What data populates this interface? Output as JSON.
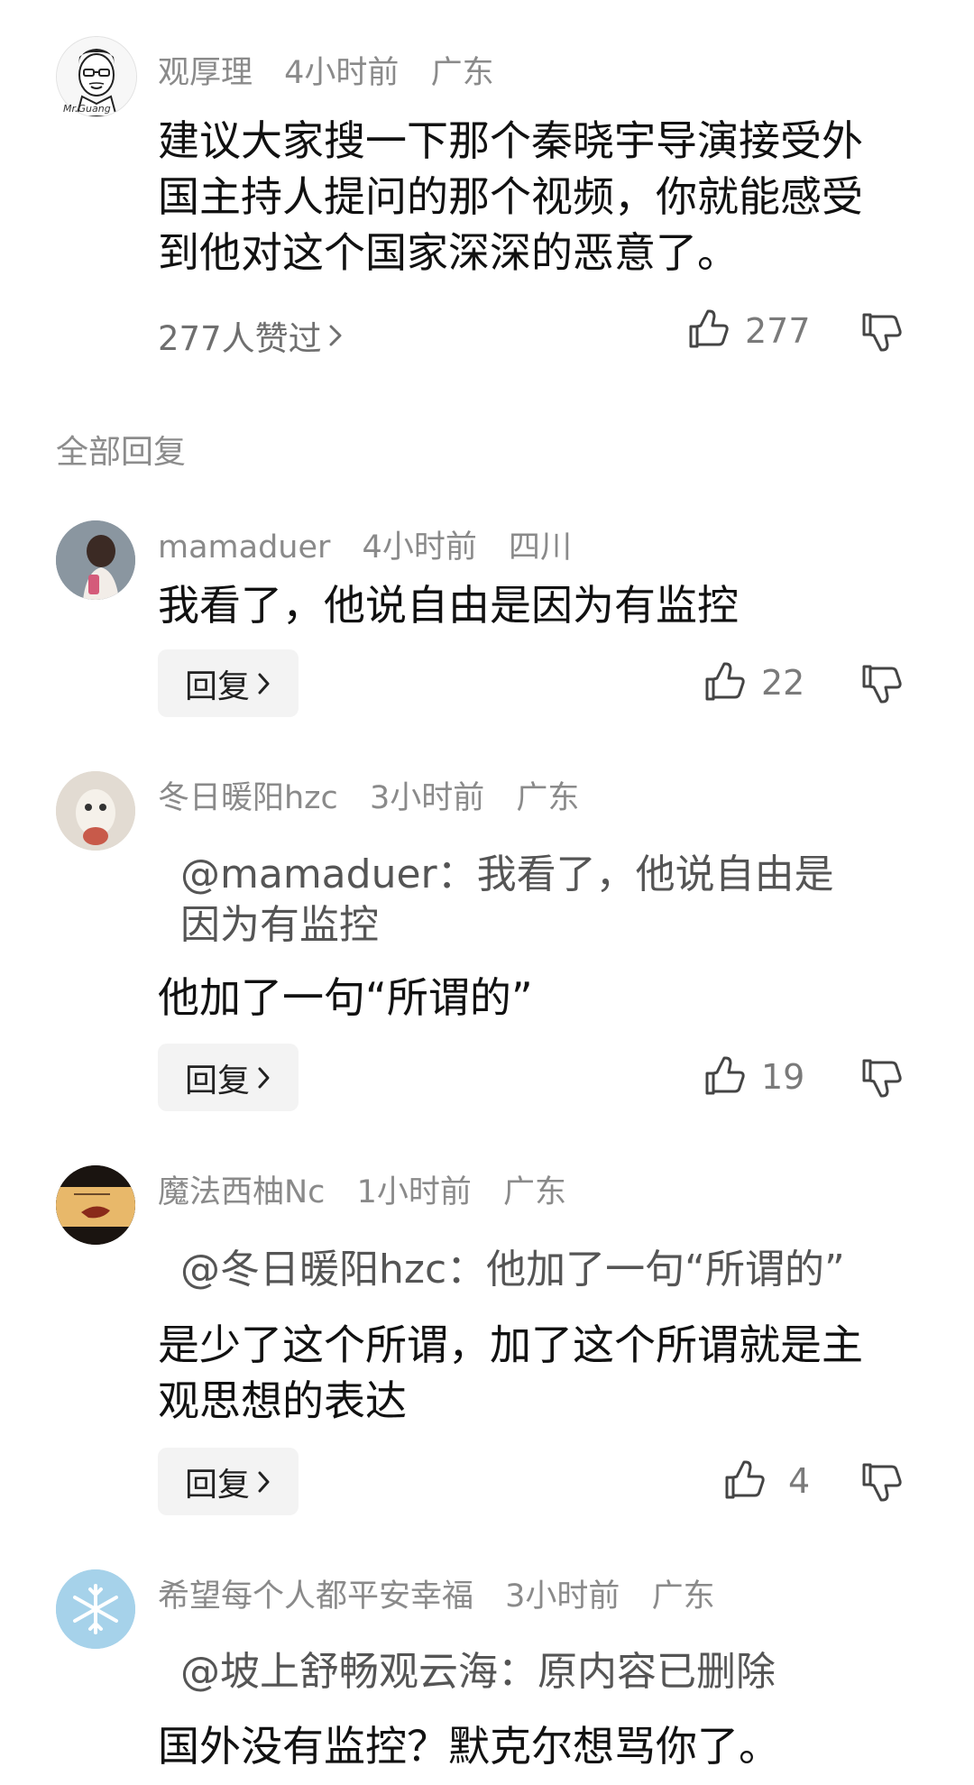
{
  "main_comment": {
    "author": "观厚理",
    "time": "4小时前",
    "location": "广东",
    "text": "建议大家搜一下那个秦晓宇导演接受外国主持人提问的那个视频，你就能感受到他对这个国家深深的恶意了。",
    "liked_by": "277人赞过",
    "like_count": "277",
    "avatar_caption": "Mr.Guang"
  },
  "section_title": "全部回复",
  "replies": [
    {
      "author": "mamaduer",
      "time": "4小时前",
      "location": "四川",
      "quote": "",
      "text": "我看了，他说自由是因为有监控",
      "reply_label": "回复",
      "like_count": "22"
    },
    {
      "author": "冬日暖阳hzc",
      "time": "3小时前",
      "location": "广东",
      "quote": "@mamaduer：我看了，他说自由是因为有监控",
      "text": "他加了一句“所谓的”",
      "reply_label": "回复",
      "like_count": "19"
    },
    {
      "author": "魔法西柚Nc",
      "time": "1小时前",
      "location": "广东",
      "quote": "@冬日暖阳hzc：他加了一句“所谓的”",
      "text": "是少了这个所谓，加了这个所谓就是主观思想的表达",
      "reply_label": "回复",
      "like_count": "4"
    },
    {
      "author": "希望每个人都平安幸福",
      "time": "3小时前",
      "location": "广东",
      "quote": "@坡上舒畅观云海：原内容已删除",
      "text": "国外没有监控？默克尔想骂你了。",
      "reply_label": "",
      "like_count": ""
    }
  ],
  "icons": {
    "like": "thumbs-up-icon",
    "dislike": "thumbs-down-icon",
    "chevron": "chevron-right-icon"
  }
}
